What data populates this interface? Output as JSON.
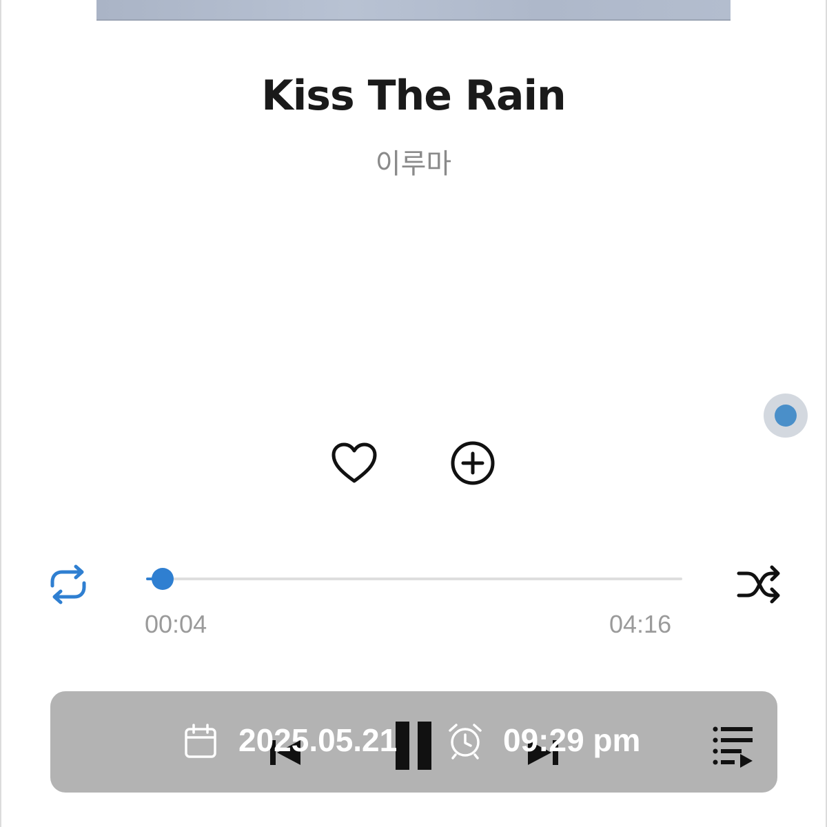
{
  "track": {
    "title": "Kiss The Rain",
    "artist": "이루마"
  },
  "progress": {
    "current_time": "00:04",
    "duration": "04:16",
    "fraction": 0.016
  },
  "overlay": {
    "date": "2025.05.21",
    "time": "09:29 pm"
  },
  "controls": {
    "repeat_active": true,
    "shuffle_active": false,
    "is_playing": true
  },
  "icons": [
    "heart-icon",
    "add-circle-icon",
    "repeat-icon",
    "shuffle-icon",
    "previous-icon",
    "pause-icon",
    "next-icon",
    "playlist-icon",
    "calendar-icon",
    "alarm-clock-icon"
  ],
  "colors": {
    "accent": "#2f7fd1",
    "title": "#1a1a1a",
    "subtitle": "#8a8a8a",
    "bar_background": "#b3b3b3"
  }
}
